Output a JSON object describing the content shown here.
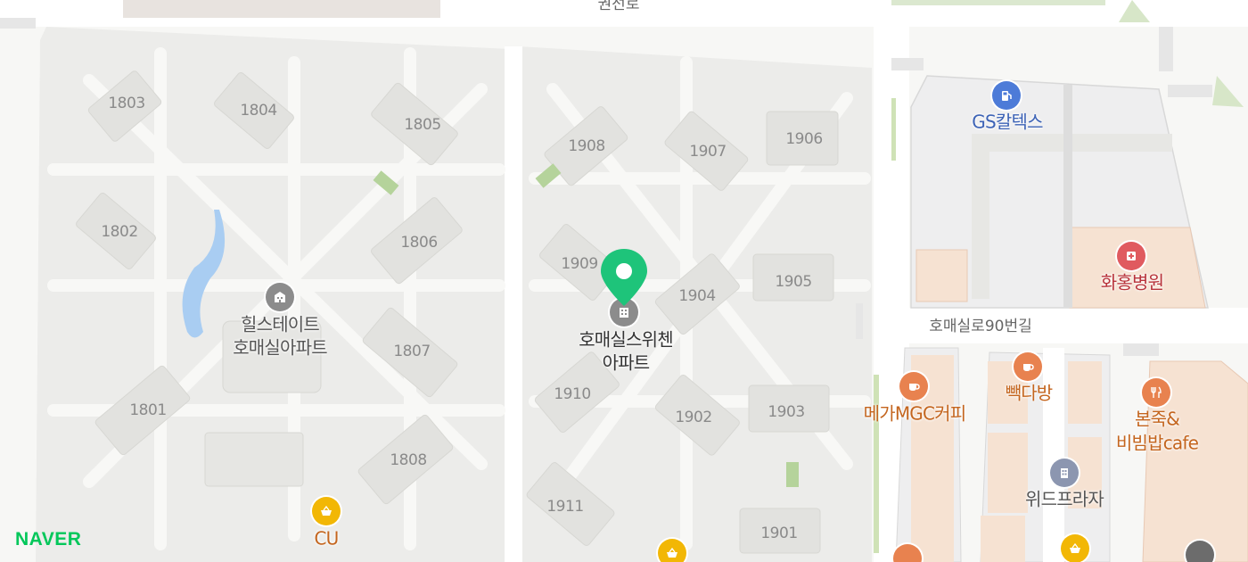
{
  "map": {
    "roads": {
      "top": "권선로",
      "right": "호매실로90번길"
    },
    "buildings": [
      "1803",
      "1804",
      "1805",
      "1802",
      "1806",
      "1807",
      "1801",
      "1808",
      "1908",
      "1907",
      "1906",
      "1909",
      "1904",
      "1905",
      "1910",
      "1902",
      "1903",
      "1911",
      "1901"
    ],
    "complexes": {
      "left": {
        "line1": "힐스테이트",
        "line2": "호매실아파트"
      },
      "center": {
        "line1": "호매실스위첸",
        "line2": "아파트"
      }
    },
    "pois": {
      "gas_station": "GS칼텍스",
      "hospital": "화홍병원",
      "cafe_mega": "메가MGC커피",
      "cafe_paik": "빽다방",
      "restaurant": {
        "line1": "본죽&",
        "line2": "비빔밥cafe"
      },
      "plaza": "위드프라자",
      "store_cu": "CU"
    },
    "brand": "NAVER"
  },
  "colors": {
    "pin": "#1ec47a",
    "gas_icon": "#4d7bd8",
    "hospital_icon": "#e05a5f",
    "cafe_icon": "#e8824f",
    "store_icon": "#f2b705",
    "building_icon": "#8c8c8c",
    "naver": "#03c75a"
  },
  "icons": [
    "pin-marker-icon",
    "apartment-icon",
    "gas-pump-icon",
    "hospital-cross-icon",
    "coffee-cup-icon",
    "restaurant-utensils-icon",
    "office-building-icon",
    "shopping-basket-icon"
  ]
}
